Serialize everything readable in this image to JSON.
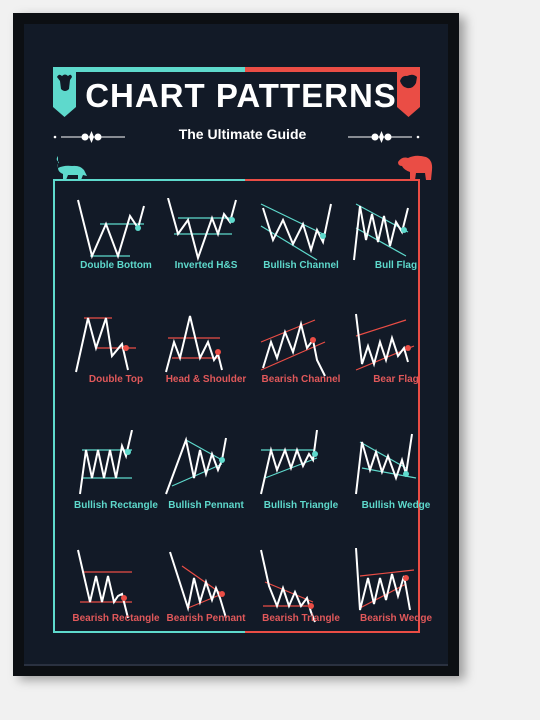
{
  "poster": {
    "title": "CHART PATTERNS",
    "subtitle": "The Ultimate Guide",
    "colors": {
      "bullish": "#5ed9cc",
      "bearish": "#ea4d45",
      "background": "#121a27",
      "frame": "#0c0f13",
      "line": "#ffffff"
    },
    "icons": {
      "left_shield": "bull-head-icon",
      "right_shield": "bear-head-icon",
      "left_animal": "bull-icon",
      "right_animal": "bear-icon",
      "ornament": "flourish-divider-icon"
    }
  },
  "patterns": [
    {
      "name": "Double Bottom",
      "type": "bullish"
    },
    {
      "name": "Inverted H&S",
      "type": "bullish"
    },
    {
      "name": "Bullish Channel",
      "type": "bullish"
    },
    {
      "name": "Bull Flag",
      "type": "bullish"
    },
    {
      "name": "Double Top",
      "type": "bearish"
    },
    {
      "name": "Head & Shoulder",
      "type": "bearish"
    },
    {
      "name": "Bearish Channel",
      "type": "bearish"
    },
    {
      "name": "Bear Flag",
      "type": "bearish"
    },
    {
      "name": "Bullish Rectangle",
      "type": "bullish"
    },
    {
      "name": "Bullish Pennant",
      "type": "bullish"
    },
    {
      "name": "Bullish Triangle",
      "type": "bullish"
    },
    {
      "name": "Bullish Wedge",
      "type": "bullish"
    },
    {
      "name": "Bearish Rectangle",
      "type": "bearish"
    },
    {
      "name": "Bearish Pennant",
      "type": "bearish"
    },
    {
      "name": "Bearish Triangle",
      "type": "bearish"
    },
    {
      "name": "Bearish Wedge",
      "type": "bearish"
    }
  ]
}
